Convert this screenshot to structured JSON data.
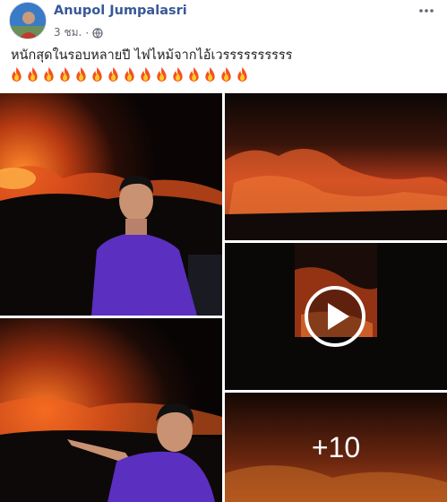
{
  "post": {
    "author": "Anupol Jumpalasri",
    "time": "3 ชม.",
    "separator": "·",
    "privacy_icon": "globe-icon",
    "menu_icon": "more-options-icon",
    "text": "หนักสุดในรอบหลายปี ไฟไหม้จากไอ้เวรรรรรรรรรร",
    "emoji": "🔥🔥🔥🔥🔥🔥🔥🔥🔥🔥🔥🔥🔥🔥🔥",
    "emoji_count": 15
  },
  "gallery": {
    "more_label": "+10",
    "video_icon": "play-icon"
  },
  "colors": {
    "author": "#385898",
    "meta": "#616770",
    "fire_glow": "#f25a1d",
    "shirt": "#5b2fbf"
  }
}
